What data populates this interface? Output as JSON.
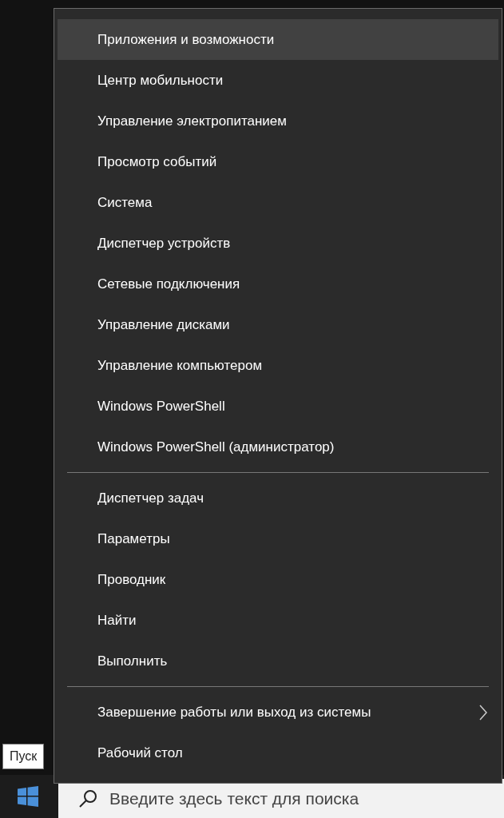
{
  "menu": {
    "groups": [
      {
        "items": [
          {
            "label": "Приложения и возможности",
            "selected": true,
            "has_submenu": false
          },
          {
            "label": "Центр мобильности",
            "selected": false,
            "has_submenu": false
          },
          {
            "label": "Управление электропитанием",
            "selected": false,
            "has_submenu": false
          },
          {
            "label": "Просмотр событий",
            "selected": false,
            "has_submenu": false
          },
          {
            "label": "Система",
            "selected": false,
            "has_submenu": false
          },
          {
            "label": "Диспетчер устройств",
            "selected": false,
            "has_submenu": false
          },
          {
            "label": "Сетевые подключения",
            "selected": false,
            "has_submenu": false
          },
          {
            "label": "Управление дисками",
            "selected": false,
            "has_submenu": false
          },
          {
            "label": "Управление компьютером",
            "selected": false,
            "has_submenu": false
          },
          {
            "label": "Windows PowerShell",
            "selected": false,
            "has_submenu": false
          },
          {
            "label": "Windows PowerShell (администратор)",
            "selected": false,
            "has_submenu": false
          }
        ]
      },
      {
        "items": [
          {
            "label": "Диспетчер задач",
            "selected": false,
            "has_submenu": false
          },
          {
            "label": "Параметры",
            "selected": false,
            "has_submenu": false
          },
          {
            "label": "Проводник",
            "selected": false,
            "has_submenu": false
          },
          {
            "label": "Найти",
            "selected": false,
            "has_submenu": false
          },
          {
            "label": "Выполнить",
            "selected": false,
            "has_submenu": false
          }
        ]
      },
      {
        "items": [
          {
            "label": "Завершение работы или выход из системы",
            "selected": false,
            "has_submenu": true
          },
          {
            "label": "Рабочий стол",
            "selected": false,
            "has_submenu": false
          }
        ]
      }
    ]
  },
  "tooltip": "Пуск",
  "taskbar": {
    "search": {
      "placeholder": "Введите здесь текст для поиска"
    }
  }
}
